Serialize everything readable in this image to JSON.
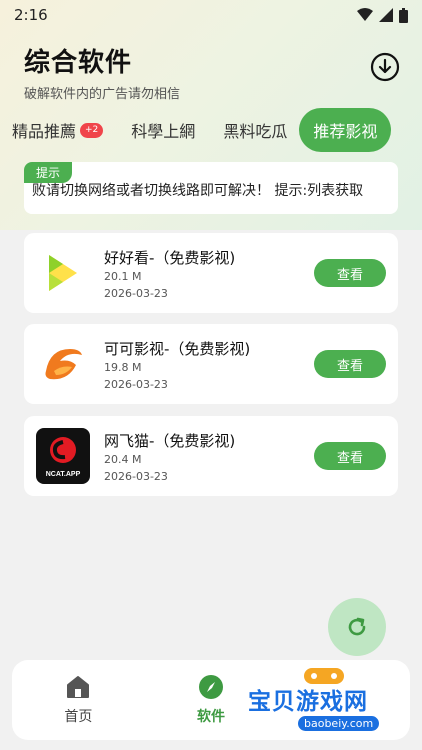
{
  "status": {
    "time": "2:16"
  },
  "header": {
    "title": "综合软件",
    "subtitle": "破解软件内的广告请勿相信"
  },
  "tabs": [
    {
      "label": "精品推薦",
      "badge": "+2"
    },
    {
      "label": "科學上網"
    },
    {
      "label": "黑料吃瓜"
    },
    {
      "label": "推荐影视",
      "active": true
    }
  ],
  "notice": {
    "tag": "提示",
    "text": "败请切换网络或者切换线路即可解决！    提示:列表获取"
  },
  "apps": [
    {
      "name": "好好看-（免费影视)",
      "size": "20.1 M",
      "date": "2026-03-23",
      "button": "查看",
      "icon": "haohaokan-icon"
    },
    {
      "name": "可可影视-（免费影视)",
      "size": "19.8 M",
      "date": "2026-03-23",
      "button": "查看",
      "icon": "keke-icon"
    },
    {
      "name": "网飞猫-（免费影视)",
      "size": "20.4 M",
      "date": "2026-03-23",
      "button": "查看",
      "icon": "ncat-icon",
      "icon_text": "NCAT.APP"
    }
  ],
  "nav": {
    "home": "首页",
    "software": "软件"
  },
  "watermark": {
    "text": "宝贝游戏网",
    "url": "baobeiy.com"
  },
  "colors": {
    "accent": "#4caf50",
    "badge": "#f0444a"
  }
}
